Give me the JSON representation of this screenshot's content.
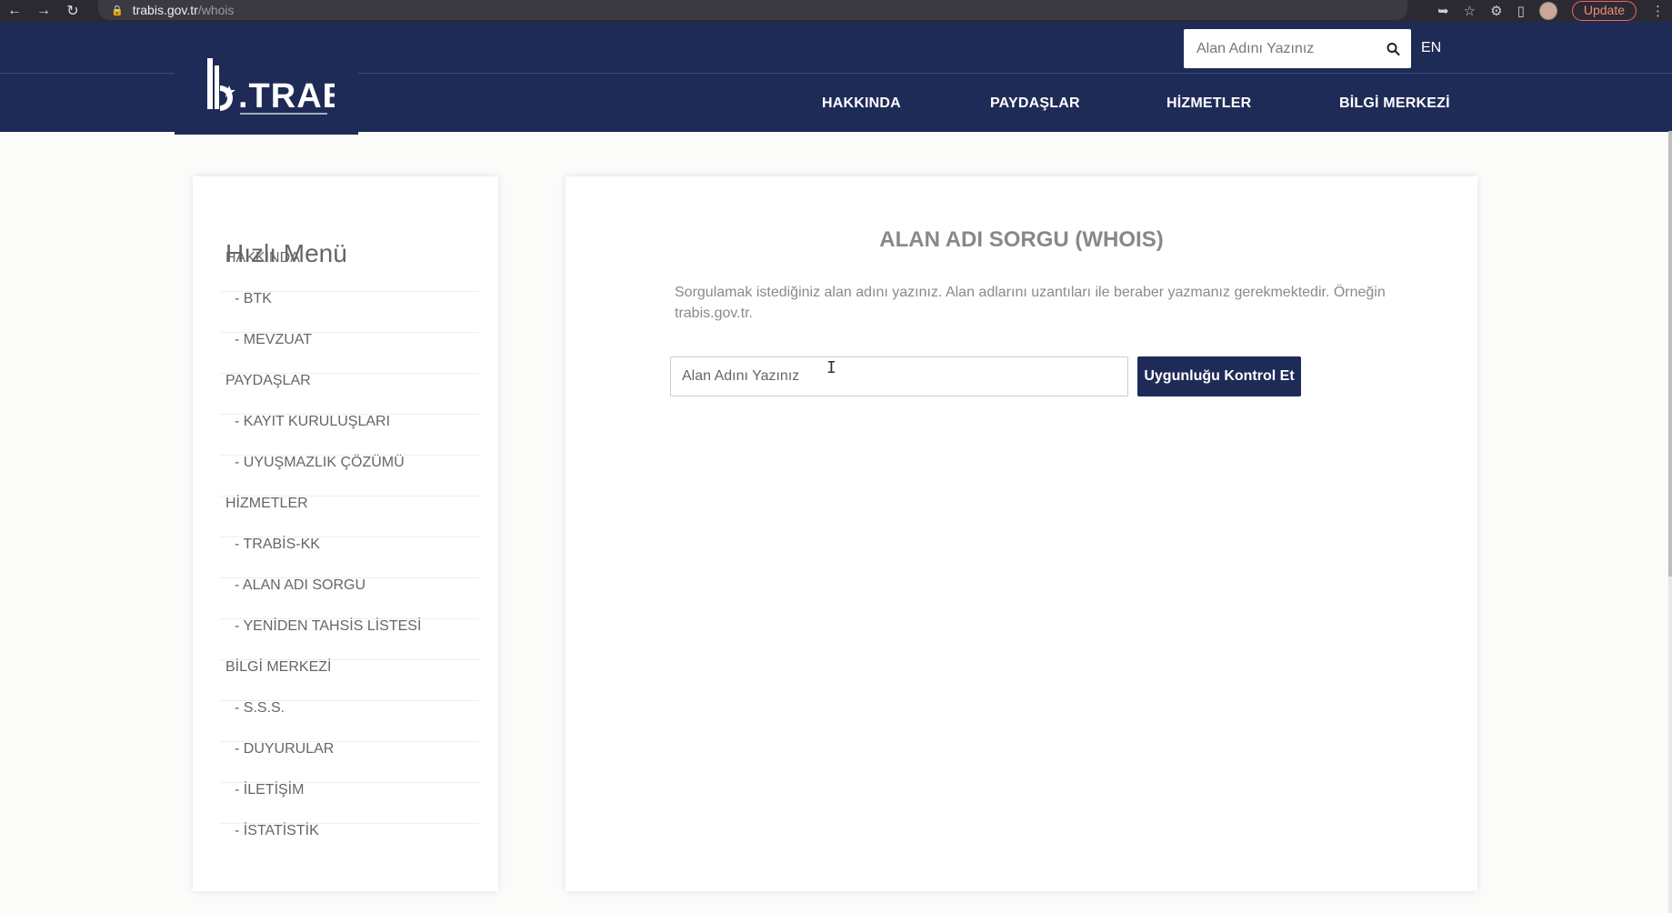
{
  "browser": {
    "url_host": "trabis.gov.tr",
    "url_path": "/whois",
    "update_label": "Update"
  },
  "header": {
    "search_placeholder": "Alan Adını Yazınız",
    "lang_label": "EN",
    "nav": {
      "hakkinda": "HAKKINDA",
      "paydaslar": "PAYDAŞLAR",
      "hizmetler": "HİZMETLER",
      "bilgi_merkezi": "BİLGİ MERKEZİ"
    }
  },
  "sidebar": {
    "title": "Hızlı Menü",
    "items": [
      {
        "label": "HAKKINDA",
        "kind": "section"
      },
      {
        "label": "- BTK",
        "kind": "sub"
      },
      {
        "label": "- MEVZUAT",
        "kind": "sub"
      },
      {
        "label": "PAYDAŞLAR",
        "kind": "section"
      },
      {
        "label": "- KAYIT KURULUŞLARI",
        "kind": "sub"
      },
      {
        "label": "- UYUŞMAZLIK ÇÖZÜMÜ",
        "kind": "sub"
      },
      {
        "label": "HİZMETLER",
        "kind": "section"
      },
      {
        "label": "- TRABİS-KK",
        "kind": "sub"
      },
      {
        "label": "- ALAN ADI SORGU",
        "kind": "sub"
      },
      {
        "label": "- YENİDEN TAHSİS LİSTESİ",
        "kind": "sub"
      },
      {
        "label": "BİLGİ MERKEZİ",
        "kind": "section"
      },
      {
        "label": "- S.S.S.",
        "kind": "sub"
      },
      {
        "label": "- DUYURULAR",
        "kind": "sub"
      },
      {
        "label": "- İLETİŞİM",
        "kind": "sub"
      },
      {
        "label": "- İSTATİSTİK",
        "kind": "sub"
      }
    ]
  },
  "main": {
    "heading": "ALAN ADI SORGU (WHOIS)",
    "description": "Sorgulamak istediğiniz alan adını yazınız. Alan adlarını uzantıları ile beraber yazmanız gerekmektedir. Örneğin trabis.gov.tr.",
    "input_placeholder": "Alan Adını Yazınız",
    "button_label": "Uygunluğu Kontrol Et"
  },
  "colors": {
    "brand_navy": "#1f2b57",
    "heading_gray": "#888888"
  }
}
